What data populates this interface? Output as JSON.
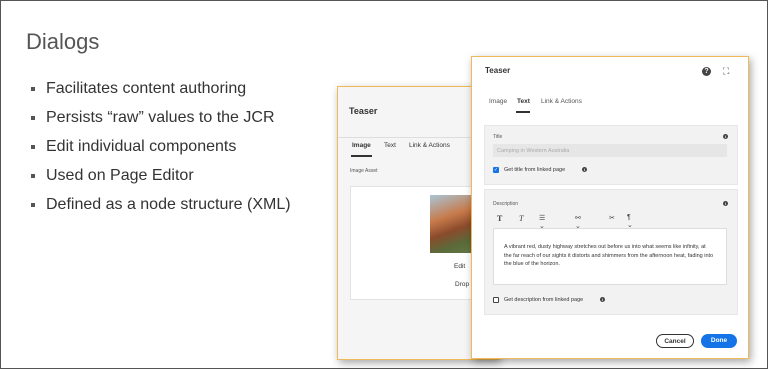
{
  "slide": {
    "title": "Dialogs",
    "bullets": [
      "Facilitates content authoring",
      "Persists “raw” values to the JCR",
      "Edit individual components",
      "Used on Page Editor",
      "Defined as a node structure (XML)"
    ]
  },
  "back_dialog": {
    "title": "Teaser",
    "tabs": [
      "Image",
      "Text",
      "Link & Actions"
    ],
    "active_tab": "Image",
    "asset_label": "Image Asset",
    "edit_label": "Edit",
    "drop_label": "Drop a"
  },
  "front_dialog": {
    "title": "Teaser",
    "icons": {
      "help": "help-icon",
      "fullscreen": "fullscreen-icon"
    },
    "tabs": [
      "Image",
      "Text",
      "Link & Actions"
    ],
    "active_tab": "Text",
    "title_label": "Title",
    "title_value": "Camping in Western Australia",
    "title_checkbox_label": "Get title from linked page",
    "title_checkbox_checked": true,
    "description_label": "Description",
    "description_text": "A vibrant red, dusty highway stretches out before us into what seems like infinity, at the far reach of our sights it distorts and shimmers from the afternoon heat, fading into the blue of the horizon.",
    "description_checkbox_label": "Get description from linked page",
    "description_checkbox_checked": false,
    "toolbar": [
      "T",
      "T",
      "☰ ⌄",
      "⚯ ⌄",
      "✂",
      "¶ ⌄"
    ],
    "cancel_label": "Cancel",
    "done_label": "Done",
    "accent": "#1473e6",
    "border_accent": "#f0b95a"
  }
}
